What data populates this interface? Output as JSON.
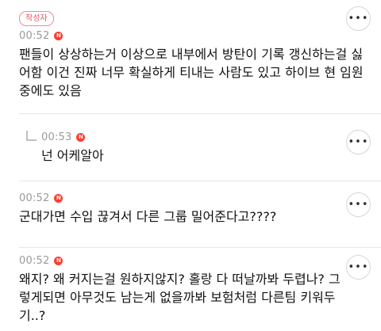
{
  "comments": [
    {
      "author_badge": "작성자",
      "time": "00:52",
      "new_badge": "N",
      "text": "팬들이 상상하는거 이상으로 내부에서 방탄이 기록 갱신하는걸 싫\n어함 이건 진짜 너무 확실하게 티내는 사람도 있고 하이브 현 임원\n중에도 있음",
      "more_icon": "more-horizontal-icon"
    },
    {
      "is_reply": true,
      "reply_icon": "reply-arrow-icon",
      "time": "00:53",
      "new_badge": "N",
      "text": "넌 어케알아",
      "more_icon": "more-horizontal-icon"
    },
    {
      "time": "00:52",
      "new_badge": "N",
      "text": "군대가면 수입 끊겨서 다른 그룹 밀어준다고????",
      "more_icon": "more-horizontal-icon"
    },
    {
      "time": "00:52",
      "new_badge": "N",
      "text": "왜지? 왜 커지는걸 원하지않지? 홀랑 다 떠날까봐 두렵나? 그\n렇게되면 아무것도 남는게 없을까봐 보험처럼 다른팀 키워두\n기..?",
      "more_icon": "more-horizontal-icon"
    }
  ],
  "more_button_label": "•••",
  "colors": {
    "new_badge": "#ff3b30",
    "author_badge": "#e85360",
    "time": "#9a9a9a",
    "divider": "#e6e6e6"
  }
}
